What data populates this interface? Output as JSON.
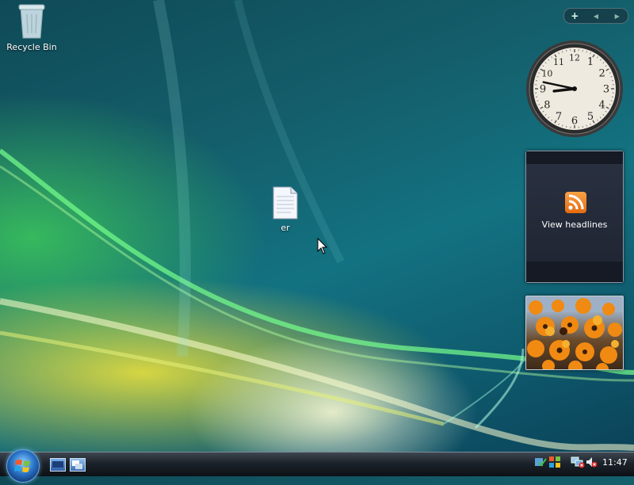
{
  "desktop": {
    "icons": [
      {
        "label": "Recycle Bin"
      },
      {
        "label": "er"
      }
    ]
  },
  "sidebar": {
    "add_gadget_symbol": "+",
    "prev_symbol": "◀",
    "next_symbol": "▶"
  },
  "clock": {
    "numbers": [
      "12",
      "1",
      "2",
      "3",
      "4",
      "5",
      "6",
      "7",
      "8",
      "9",
      "10",
      "11"
    ],
    "hour": 8,
    "minute": 47
  },
  "feed_gadget": {
    "label": "View headlines"
  },
  "taskbar": {
    "time": "11:47"
  },
  "colors": {
    "rss_orange": "#e8761a",
    "taskbar_dark": "#141a20",
    "start_blue": "#2a74c8"
  }
}
